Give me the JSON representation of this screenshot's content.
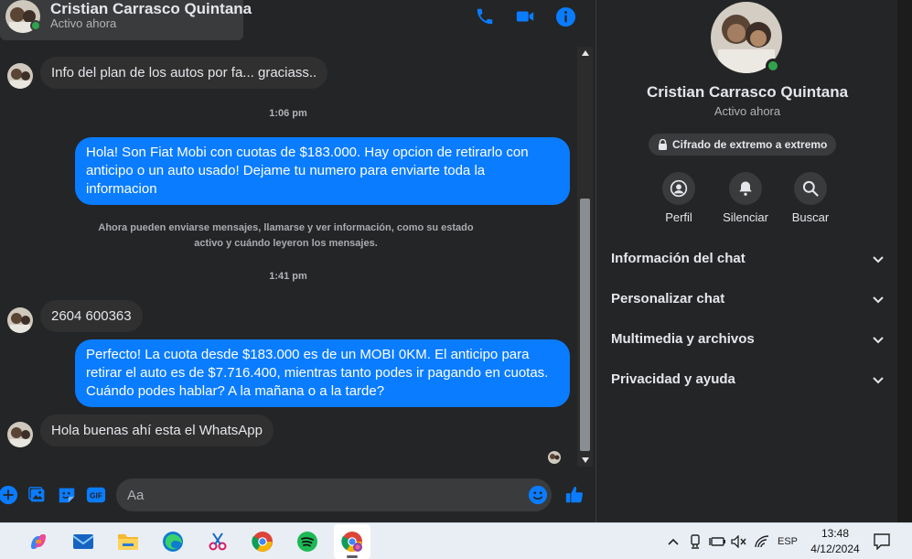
{
  "contact": {
    "name": "Cristian Carrasco Quintana",
    "status": "Activo ahora"
  },
  "messages": {
    "in1": "Info del plan de los autos por fa... graciass..",
    "time1": "1:06 pm",
    "out1": "Hola! Son Fiat Mobi con cuotas de $183.000. Hay opcion de retirarlo con anticipo o un auto usado! Dejame tu numero para enviarte toda la informacion",
    "notice": "Ahora pueden enviarse mensajes, llamarse y ver información, como su estado activo y cuándo leyeron los mensajes.",
    "time2": "1:41 pm",
    "in2": "2604 600363",
    "out2": "Perfecto! La cuota desde $183.000 es de un MOBI 0KM. El anticipo para retirar el auto es de $7.716.400, mientras tanto podes ir pagando en cuotas. Cuándo podes hablar? A la mañana o a la tarde?",
    "in3": "Hola buenas ahí esta el WhatsApp"
  },
  "composer": {
    "placeholder": "Aa"
  },
  "info": {
    "encryption": "Cifrado de extremo a extremo",
    "actions": {
      "profile": "Perfil",
      "mute": "Silenciar",
      "search": "Buscar"
    },
    "sections": [
      "Información del chat",
      "Personalizar chat",
      "Multimedia y archivos",
      "Privacidad y ayuda"
    ]
  },
  "taskbar": {
    "language": "ESP",
    "time": "13:48",
    "date": "4/12/2024"
  },
  "colors": {
    "accent": "#0a7cff",
    "online": "#31a24c",
    "incoming_bubble": "#303030",
    "background": "#242526"
  }
}
